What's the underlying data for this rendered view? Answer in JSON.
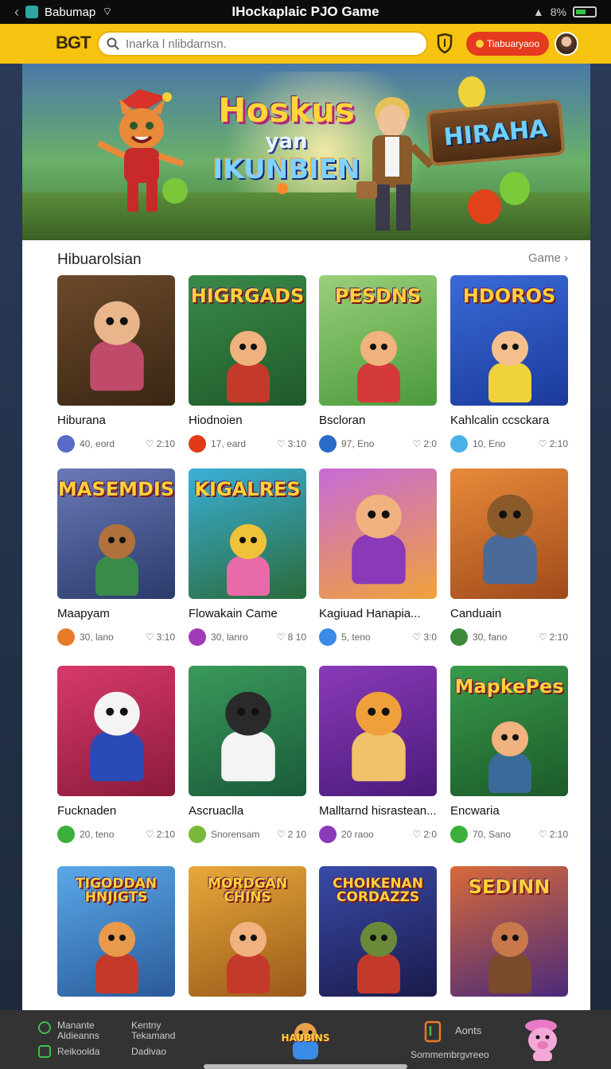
{
  "status_bar": {
    "app_name": "Babumap",
    "title": "IHockaplaic PJO Game",
    "battery_text": "8%"
  },
  "header": {
    "logo": "BGT",
    "search_placeholder": "Inarka l nlibdarnsn.",
    "promo_label": "Tiabuaryaoo"
  },
  "banner": {
    "headline_1": "Hoskus",
    "headline_2": "yan",
    "headline_3": "IKUNBIEN",
    "sign_text": "HIRAHA",
    "slide_count": 4,
    "active_slide": 0
  },
  "section": {
    "title": "Hibuarolsian",
    "link": "Game"
  },
  "games": [
    {
      "name": "Hiburana",
      "players": "40, eord",
      "time": "2:10",
      "art_title": "",
      "bg": [
        "#6b4a2a",
        "#3a2614"
      ],
      "hero": "#e8b68a",
      "shirt": "#c04a6a",
      "icon_color": "#5a6ac8"
    },
    {
      "name": "Hiodnoien",
      "players": "17, eard",
      "time": "3:10",
      "art_title": "HIGRGADS",
      "bg": [
        "#3a8a4a",
        "#1e5a2a"
      ],
      "hero": "#f0b27e",
      "shirt": "#c43a2a",
      "icon_color": "#e03a1a"
    },
    {
      "name": "Bscloran",
      "players": "97, Eno",
      "time": "2:0",
      "art_title": "PESDNS",
      "bg": [
        "#9ad07a",
        "#4a9a3a"
      ],
      "hero": "#f0b27e",
      "shirt": "#d43a3a",
      "icon_color": "#2a6ac8"
    },
    {
      "name": "Kahlcalin ccsckara",
      "players": "10, Eno",
      "time": "2:10",
      "art_title": "HDOROS",
      "bg": [
        "#3a6ad8",
        "#1a3a9a"
      ],
      "hero": "#f4c08e",
      "shirt": "#f0d23a",
      "icon_color": "#4ab0e8"
    },
    {
      "name": "Maapyam",
      "players": "30, lano",
      "time": "3:10",
      "art_title": "MASEMDIS",
      "bg": [
        "#6a7ab8",
        "#2a3a6a"
      ],
      "hero": "#b0723a",
      "shirt": "#3a8a4a",
      "icon_color": "#e87a2a"
    },
    {
      "name": "Flowakain Came",
      "players": "30, lanro",
      "time": "8 10",
      "art_title": "KIGALRES",
      "bg": [
        "#3ab0d8",
        "#2a6a3a"
      ],
      "hero": "#f0c23a",
      "shirt": "#e86aa8",
      "icon_color": "#a03ab8"
    },
    {
      "name": "Kagiuad Hanapia...",
      "players": "5, teno",
      "time": "3:0",
      "art_title": "",
      "bg": [
        "#c86ad8",
        "#f0a23a"
      ],
      "hero": "#f0b27e",
      "shirt": "#8a3ab8",
      "icon_color": "#3a8ae8"
    },
    {
      "name": "Canduain",
      "players": "30, fano",
      "time": "2:10",
      "art_title": "",
      "bg": [
        "#e88a3a",
        "#a04a1a"
      ],
      "hero": "#8a5a2a",
      "shirt": "#4a6a9a",
      "icon_color": "#3a8a3a"
    },
    {
      "name": "Fucknaden",
      "players": "20, teno",
      "time": "2:10",
      "art_title": "",
      "bg": [
        "#d83a6a",
        "#8a1a3a"
      ],
      "hero": "#f4f4f4",
      "shirt": "#2a4ab8",
      "icon_color": "#3ab03a"
    },
    {
      "name": "Ascruaclla",
      "players": "Snorensam",
      "time": "2 10",
      "art_title": "",
      "bg": [
        "#3a9a5a",
        "#1a5a3a"
      ],
      "hero": "#2a2a2a",
      "shirt": "#f4f4f4",
      "icon_color": "#7ab83a"
    },
    {
      "name": "Malltarnd hisrastean...",
      "players": "20 raoo",
      "time": "2:0",
      "art_title": "",
      "bg": [
        "#8a3ab8",
        "#4a1a7a"
      ],
      "hero": "#f0a03a",
      "shirt": "#f0c26a",
      "icon_color": "#8a3ab8"
    },
    {
      "name": "Encwaria",
      "players": "70, Sano",
      "time": "2:10",
      "art_title": "MapkePes",
      "bg": [
        "#3a9a4a",
        "#1a5a2a"
      ],
      "hero": "#f0b27e",
      "shirt": "#3a6a9a",
      "icon_color": "#3ab03a"
    },
    {
      "name": "",
      "players": "",
      "time": "",
      "art_title": "TIGODDAN HNJIGTS",
      "bg": [
        "#5aa8e8",
        "#2a5a9a"
      ],
      "hero": "#e89a4a",
      "shirt": "#c43a2a",
      "icon_color": "#888888"
    },
    {
      "name": "",
      "players": "",
      "time": "",
      "art_title": "MORDGAN CHINS",
      "bg": [
        "#e8a83a",
        "#9a5a1a"
      ],
      "hero": "#f0b27e",
      "shirt": "#c43a2a",
      "icon_color": "#888888"
    },
    {
      "name": "",
      "players": "",
      "time": "",
      "art_title": "CHOIKENAN CORDAZZS",
      "bg": [
        "#3a4aa8",
        "#1a1a4a"
      ],
      "hero": "#6a8a3a",
      "shirt": "#c43a2a",
      "icon_color": "#888888"
    },
    {
      "name": "",
      "players": "",
      "time": "",
      "art_title": "SEDINN",
      "bg": [
        "#d86a3a",
        "#4a2a7a"
      ],
      "hero": "#c8784a",
      "shirt": "#7a4a2a",
      "icon_color": "#888888"
    }
  ],
  "bottom_bar": {
    "item_1a": "Manante",
    "item_1b": "Aldieanns",
    "item_2a": "Kentny",
    "item_2b": "Tekamand",
    "item_3": "Reikoolda",
    "item_4": "Dadivao",
    "mascot_label": "HAUBINS",
    "right_label": "Aonts",
    "right_sub": "Sommembrgvreeo"
  },
  "colors": {
    "header_bg": "#f6c310",
    "promo_bg": "#e53a1f",
    "bottom_bg": "#333333",
    "accent_green": "#3bbf4a"
  }
}
